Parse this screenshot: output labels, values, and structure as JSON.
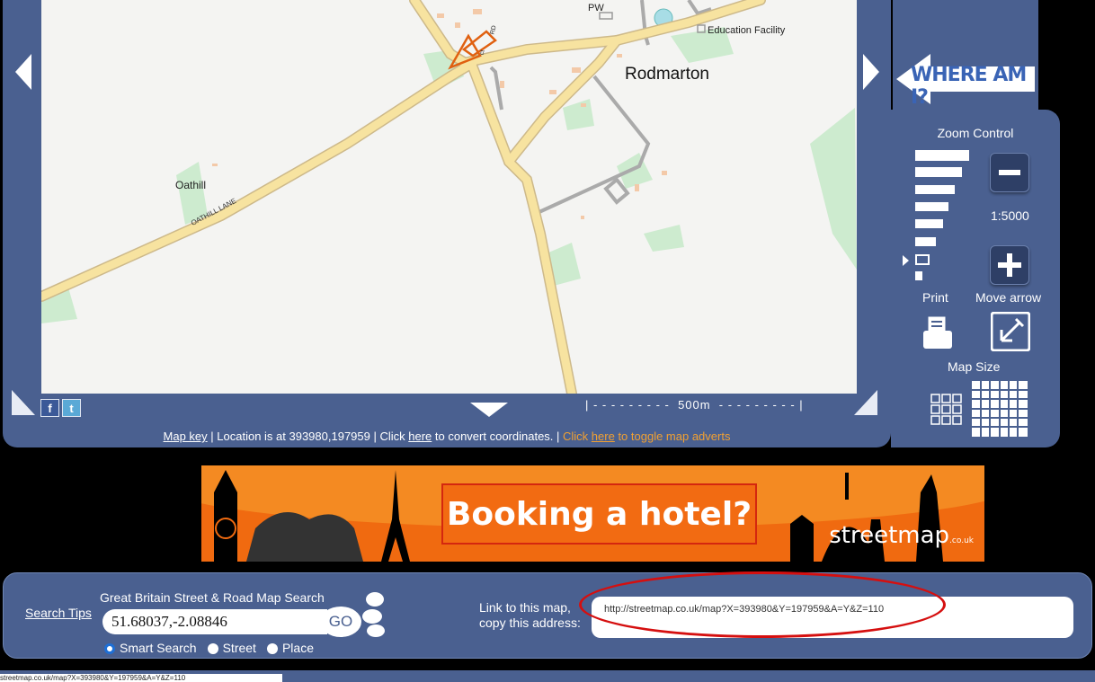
{
  "map": {
    "labels": {
      "pw": "PW",
      "education": "Education Facility",
      "village": "Rodmarton",
      "oathill": "Oathill",
      "lane": "OATHILL LANE",
      "road_frag": "RD",
      "road_frag2": "ct"
    },
    "scale_text": "| - - - - - - - - -  500m  - - - - - - - - - |"
  },
  "status": {
    "map_key": "Map key",
    "location_text": " | Location is at 393980,197959 | Click ",
    "here1": "here",
    "convert_text": " to convert coordinates. | ",
    "click2": "Click ",
    "here2": "here",
    "toggle_text": " to toggle map adverts"
  },
  "sidebar": {
    "where_am_i": "WHERE AM I?",
    "zoom_title": "Zoom Control",
    "scale": "1:5000",
    "print_label": "Print",
    "move_arrow_label": "Move arrow",
    "map_size_label": "Map Size"
  },
  "ad": {
    "headline": "Booking a hotel?",
    "brand": "streetmap",
    "brand_suffix": ".co.uk"
  },
  "search": {
    "tips": "Search Tips",
    "title": "Great Britain Street & Road Map Search",
    "input_value": "51.68037,-2.08846",
    "go": "GO",
    "options": [
      "Smart Search",
      "Street",
      "Place"
    ],
    "selected": "Smart Search",
    "link_label_1": "Link to this map,",
    "link_label_2": "copy this address:",
    "link_value": "http://streetmap.co.uk/map?X=393980&Y=197959&A=Y&Z=110"
  },
  "bottom": {
    "status_text": "streetmap.co.uk/map?X=393980&Y=197959&A=Y&Z=110"
  },
  "colors": {
    "panel": "#4a6090",
    "road": "#f7e3a0",
    "orange_link": "#f0a033",
    "ad_bg": "#f06a10",
    "highlight_ellipse": "#d50f0f"
  }
}
